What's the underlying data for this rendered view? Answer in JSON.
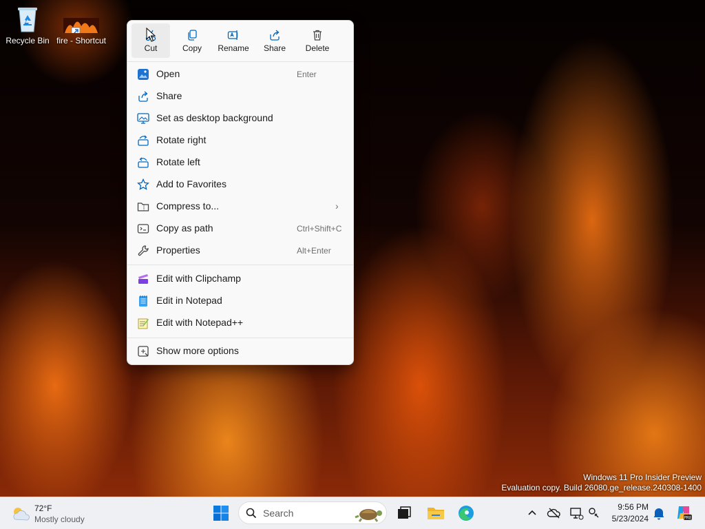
{
  "desktop": {
    "icons": [
      {
        "label": "Recycle Bin",
        "icon": "recycle-bin-icon"
      },
      {
        "label": "fire - Shortcut",
        "icon": "image-shortcut-icon"
      }
    ],
    "watermark": {
      "line1": "Windows 11 Pro Insider Preview",
      "line2": "Evaluation copy. Build 26080.ge_release.240308-1400"
    }
  },
  "context_menu": {
    "quick_actions": [
      {
        "label": "Cut",
        "icon": "cut-icon"
      },
      {
        "label": "Copy",
        "icon": "copy-icon"
      },
      {
        "label": "Rename",
        "icon": "rename-icon"
      },
      {
        "label": "Share",
        "icon": "share-icon"
      },
      {
        "label": "Delete",
        "icon": "delete-icon"
      }
    ],
    "items": [
      {
        "label": "Open",
        "shortcut": "Enter",
        "icon": "photos-icon"
      },
      {
        "label": "Share",
        "shortcut": "",
        "icon": "share-icon"
      },
      {
        "label": "Set as desktop background",
        "shortcut": "",
        "icon": "desktop-background-icon"
      },
      {
        "label": "Rotate right",
        "shortcut": "",
        "icon": "rotate-right-icon"
      },
      {
        "label": "Rotate left",
        "shortcut": "",
        "icon": "rotate-left-icon"
      },
      {
        "label": "Add to Favorites",
        "shortcut": "",
        "icon": "star-icon"
      },
      {
        "label": "Compress to...",
        "shortcut": "",
        "icon": "zip-folder-icon"
      },
      {
        "label": "Copy as path",
        "shortcut": "Ctrl+Shift+C",
        "icon": "copy-path-icon"
      },
      {
        "label": "Properties",
        "shortcut": "Alt+Enter",
        "icon": "wrench-icon"
      },
      {
        "label": "Edit with Clipchamp",
        "shortcut": "",
        "icon": "clipchamp-icon"
      },
      {
        "label": "Edit in Notepad",
        "shortcut": "",
        "icon": "notepad-icon"
      },
      {
        "label": "Edit with Notepad++",
        "shortcut": "",
        "icon": "notepad-plus-plus-icon"
      },
      {
        "label": "Show more options",
        "shortcut": "",
        "icon": "more-options-icon"
      }
    ]
  },
  "taskbar": {
    "weather": {
      "temp": "72°F",
      "condition": "Mostly cloudy"
    },
    "search_placeholder": "Search",
    "clock": {
      "time": "9:56 PM",
      "date": "5/23/2024"
    }
  },
  "colors": {
    "accent": "#0067c0",
    "menu_bg": "#f9f9f9",
    "taskbar_bg": "#eef0f4"
  }
}
